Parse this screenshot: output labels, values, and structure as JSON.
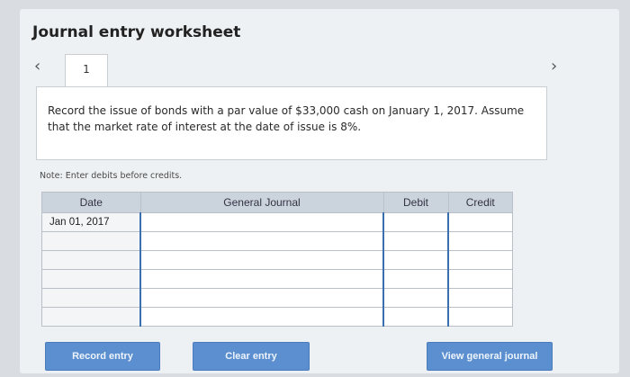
{
  "header": {
    "title": "Journal entry worksheet"
  },
  "navigation": {
    "prev_icon": "‹",
    "next_icon": "›",
    "current_tab": "1"
  },
  "prompt": {
    "text": "Record the issue of bonds with a par value of $33,000 cash on January 1, 2017. Assume that the market rate of interest at the date of issue is 8%."
  },
  "note": "Note: Enter debits before credits.",
  "table": {
    "headers": {
      "date": "Date",
      "journal": "General Journal",
      "debit": "Debit",
      "credit": "Credit"
    },
    "rows": [
      {
        "date": "Jan 01, 2017",
        "journal": "",
        "debit": "",
        "credit": ""
      },
      {
        "date": "",
        "journal": "",
        "debit": "",
        "credit": ""
      },
      {
        "date": "",
        "journal": "",
        "debit": "",
        "credit": ""
      },
      {
        "date": "",
        "journal": "",
        "debit": "",
        "credit": ""
      },
      {
        "date": "",
        "journal": "",
        "debit": "",
        "credit": ""
      },
      {
        "date": "",
        "journal": "",
        "debit": "",
        "credit": ""
      }
    ]
  },
  "buttons": {
    "record": "Record entry",
    "clear": "Clear entry",
    "view": "View general journal"
  },
  "colors": {
    "button_blue": "#5b8fd0",
    "header_gray": "#cbd3dc",
    "input_border": "#3a6fb0"
  }
}
